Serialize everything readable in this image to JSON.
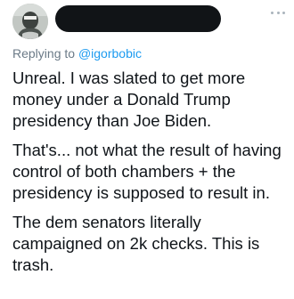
{
  "tweet": {
    "avatar": {
      "icon": "user-avatar-photo"
    },
    "author_name": "",
    "more_icon": "more-horizontal-icon",
    "reply": {
      "prefix": "Replying to ",
      "handle": "@igorbobic"
    },
    "paragraphs": [
      "Unreal. I was slated to get more\nmoney under a Donald Trump\npresidency than Joe Biden.",
      "That's... not what the result of having\ncontrol of both chambers + the\npresidency is supposed to result in.",
      "The dem senators literally\ncampaigned on 2k checks. This is\ntrash."
    ]
  },
  "colors": {
    "text": "#0f1419",
    "secondary": "#6b7a87",
    "link": "#1d9bf0",
    "redaction": "#111417"
  }
}
